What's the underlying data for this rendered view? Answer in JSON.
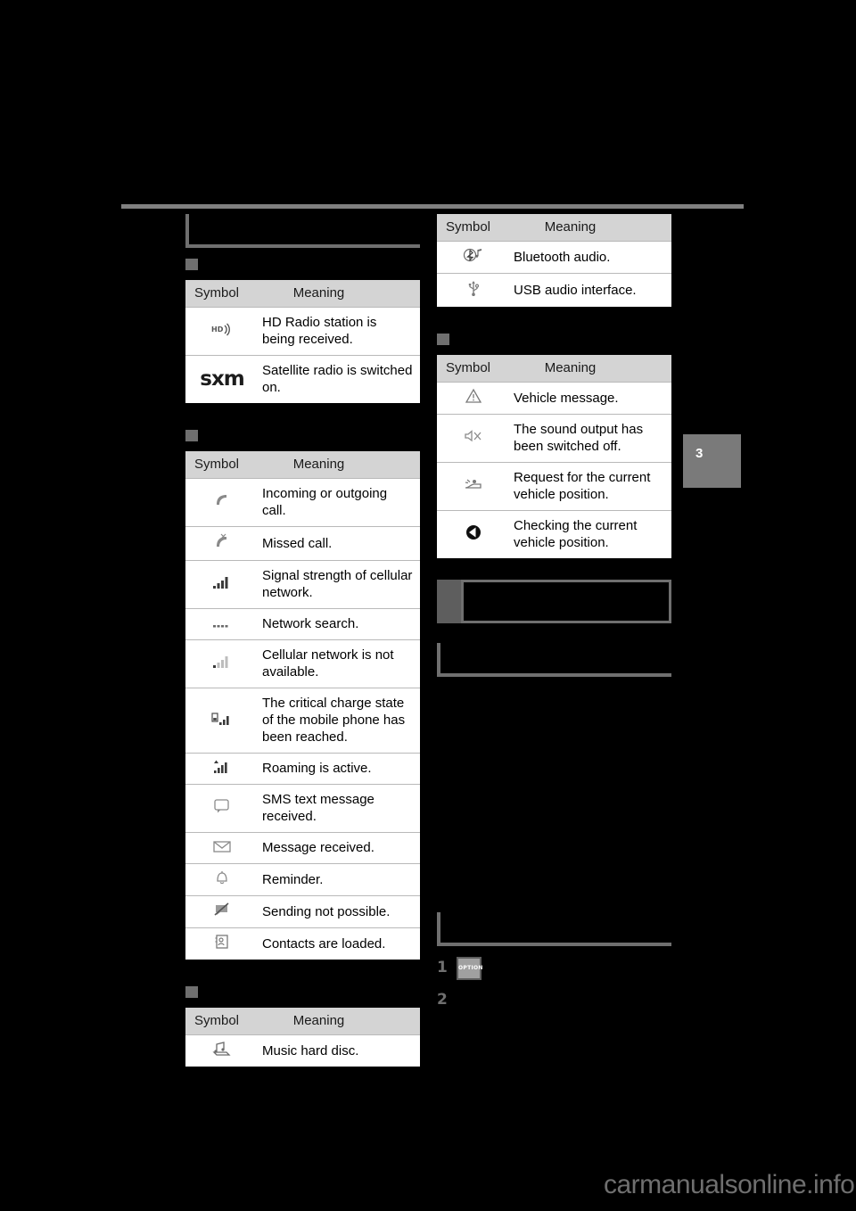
{
  "page": {
    "chapter_tab": "3",
    "watermark": "carmanualsonline.info"
  },
  "columns": {
    "left": {
      "heading": "",
      "sections": [
        {
          "sub_heading": "",
          "table": {
            "col_symbol": "Symbol",
            "col_meaning": "Meaning",
            "rows": [
              {
                "icon": "hd-radio-icon",
                "meaning": "HD Radio station is being received."
              },
              {
                "icon": "sxm-logo-icon",
                "meaning": "Satellite radio is switched on."
              }
            ]
          }
        },
        {
          "sub_heading": "",
          "table": {
            "col_symbol": "Symbol",
            "col_meaning": "Meaning",
            "rows": [
              {
                "icon": "phone-handset-icon",
                "meaning": "Incoming or outgoing call."
              },
              {
                "icon": "missed-call-icon",
                "meaning": "Missed call."
              },
              {
                "icon": "signal-bars-icon",
                "meaning": "Signal strength of cellular network."
              },
              {
                "icon": "network-search-icon",
                "meaning": "Network search."
              },
              {
                "icon": "signal-bars-empty-icon",
                "meaning": "Cellular network is not available."
              },
              {
                "icon": "low-battery-signal-icon",
                "meaning": "The critical charge state of the mobile phone has been reached."
              },
              {
                "icon": "roaming-icon",
                "meaning": "Roaming is active."
              },
              {
                "icon": "sms-bubble-icon",
                "meaning": "SMS text message received."
              },
              {
                "icon": "envelope-icon",
                "meaning": "Message received."
              },
              {
                "icon": "bell-icon",
                "meaning": "Reminder."
              },
              {
                "icon": "sending-not-possible-icon",
                "meaning": "Sending not possible."
              },
              {
                "icon": "contacts-loaded-icon",
                "meaning": "Contacts are loaded."
              }
            ]
          }
        },
        {
          "sub_heading": "",
          "table": {
            "col_symbol": "Symbol",
            "col_meaning": "Meaning",
            "rows": [
              {
                "icon": "music-hard-disc-icon",
                "meaning": "Music hard disc."
              }
            ]
          }
        }
      ]
    },
    "right": {
      "sections": [
        {
          "table": {
            "col_symbol": "Symbol",
            "col_meaning": "Meaning",
            "rows": [
              {
                "icon": "bluetooth-audio-icon",
                "meaning": "Bluetooth audio."
              },
              {
                "icon": "usb-icon",
                "meaning": "USB audio interface."
              }
            ]
          }
        },
        {
          "sub_heading": "",
          "table": {
            "col_symbol": "Symbol",
            "col_meaning": "Meaning",
            "rows": [
              {
                "icon": "warning-triangle-icon",
                "meaning": "Vehicle message."
              },
              {
                "icon": "mute-speaker-icon",
                "meaning": "The sound output has been switched off."
              },
              {
                "icon": "vehicle-position-request-icon",
                "meaning": "Request for the current vehicle position."
              },
              {
                "icon": "compass-icon",
                "meaning": "Checking the current vehicle position."
              }
            ]
          }
        }
      ],
      "note_box": "",
      "heading_after_note": "",
      "heading_before_steps": "",
      "steps": [
        {
          "number": "1",
          "key_label": "OPTION",
          "text": ""
        },
        {
          "number": "2",
          "key_label": "",
          "text": ""
        }
      ]
    }
  }
}
